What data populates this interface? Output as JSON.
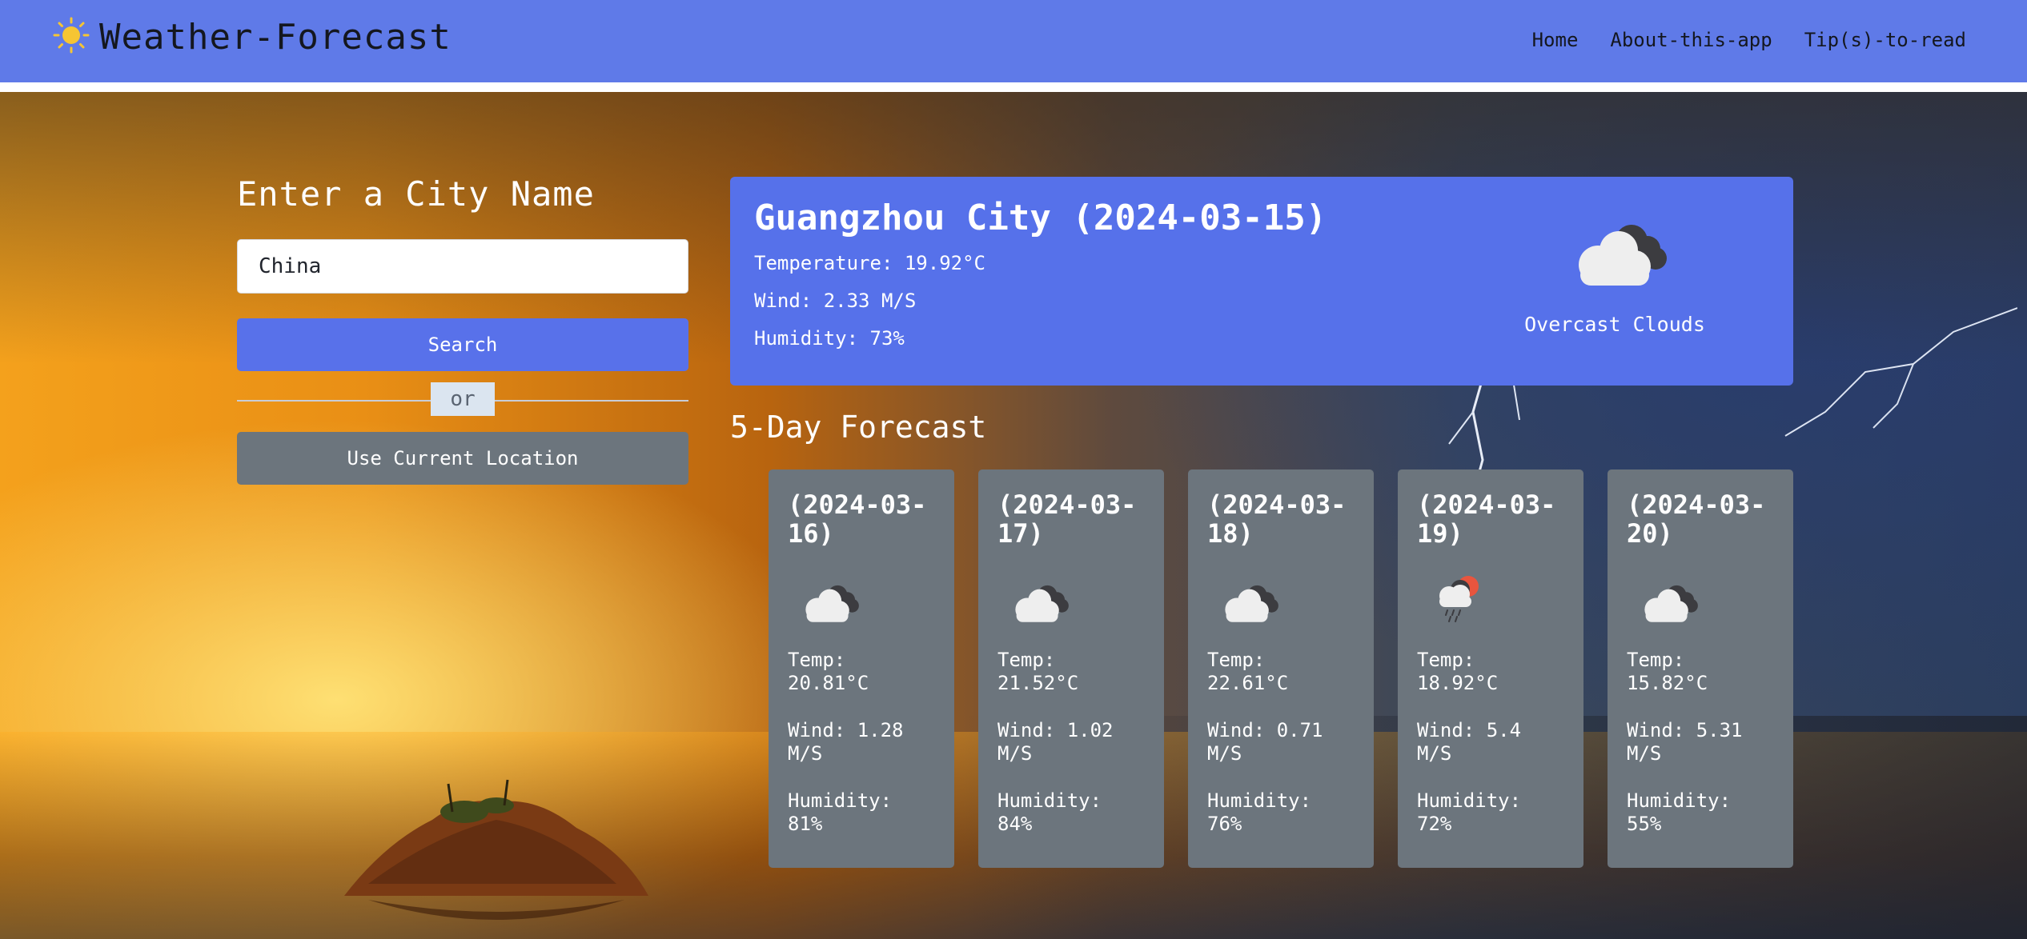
{
  "navbar": {
    "brand": "Weather-Forecast",
    "links": [
      "Home",
      "About-this-app",
      "Tip(s)-to-read"
    ]
  },
  "search": {
    "title": "Enter a City Name",
    "input_value": "China",
    "search_label": "Search",
    "divider_text": "or",
    "location_label": "Use Current Location"
  },
  "current": {
    "title": "Guangzhou City (2024-03-15)",
    "temperature": "Temperature: 19.92°C",
    "wind": "Wind: 2.33 M/S",
    "humidity": "Humidity: 73%",
    "description": "Overcast Clouds",
    "icon": "overcast-clouds-icon"
  },
  "forecast": {
    "heading": "5-Day Forecast",
    "days": [
      {
        "date": "(2024-03-16)",
        "icon": "overcast-clouds-icon",
        "temp_label": "Temp:",
        "temp": "20.81°C",
        "wind_label": "Wind: 1.28",
        "wind_unit": "M/S",
        "humidity_label": "Humidity:",
        "humidity": "81%"
      },
      {
        "date": "(2024-03-17)",
        "icon": "overcast-clouds-icon",
        "temp_label": "Temp:",
        "temp": "21.52°C",
        "wind_label": "Wind: 1.02",
        "wind_unit": "M/S",
        "humidity_label": "Humidity:",
        "humidity": "84%"
      },
      {
        "date": "(2024-03-18)",
        "icon": "overcast-clouds-icon",
        "temp_label": "Temp:",
        "temp": "22.61°C",
        "wind_label": "Wind: 0.71",
        "wind_unit": "M/S",
        "humidity_label": "Humidity:",
        "humidity": "76%"
      },
      {
        "date": "(2024-03-19)",
        "icon": "light-rain-icon",
        "temp_label": "Temp:",
        "temp": "18.92°C",
        "wind_label": "Wind: 5.4",
        "wind_unit": "M/S",
        "humidity_label": "Humidity:",
        "humidity": "72%"
      },
      {
        "date": "(2024-03-20)",
        "icon": "overcast-clouds-icon",
        "temp_label": "Temp:",
        "temp": "15.82°C",
        "wind_label": "Wind: 5.31",
        "wind_unit": "M/S",
        "humidity_label": "Humidity:",
        "humidity": "55%"
      }
    ]
  },
  "colors": {
    "navbar": "#5f7ae8",
    "primary": "#5671ea",
    "secondary": "#6c757d",
    "sun": "#f6c533"
  }
}
